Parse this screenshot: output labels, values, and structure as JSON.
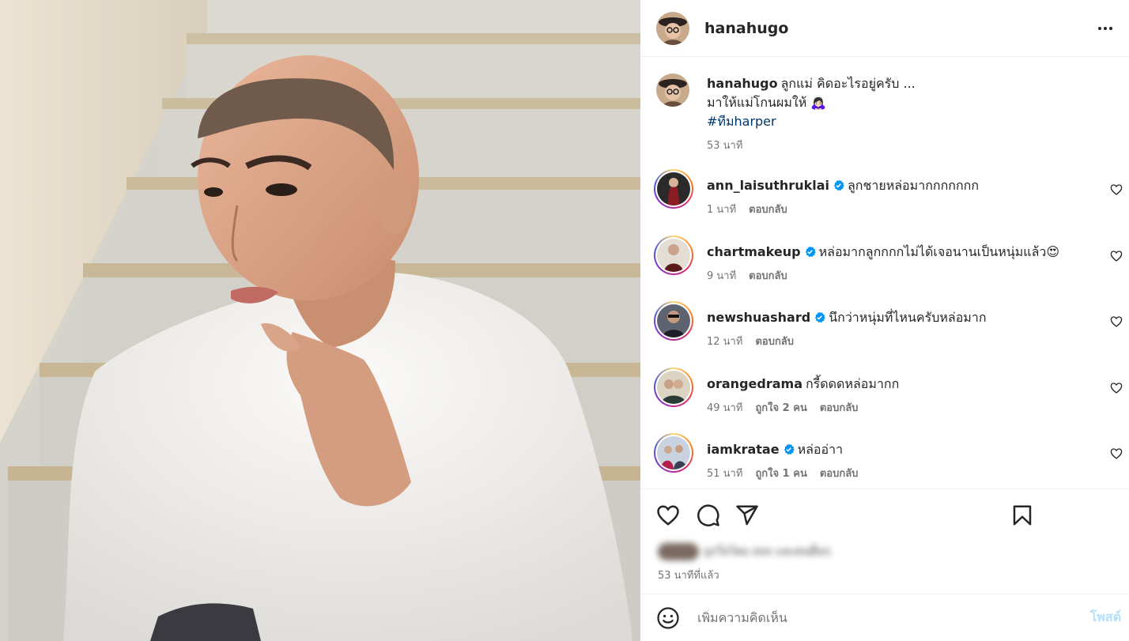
{
  "post": {
    "author": "hanahugo",
    "caption": {
      "username": "hanahugo",
      "line1": "ลูกแม่ คิดอะไรอยู่ครับ ...",
      "line2": "มาให้แม่โกนผมให้ 🙇🏻‍♀️",
      "hashtag": "#ทีมharper",
      "time": "53 นาที"
    },
    "timestamp": "53 นาทีที่แล้ว",
    "liked_by_blurred": "ถูกใจโดย xxx และคนอื่นๆ"
  },
  "comments": [
    {
      "username": "ann_laisuthruklai",
      "verified": true,
      "text": "ลูกชายหล่อมากกกกกกก",
      "time": "1 นาที",
      "likes": "",
      "reply": "ตอบกลับ"
    },
    {
      "username": "chartmakeup",
      "verified": true,
      "text": "หล่อมากลูกกกกไม่ได้เจอนานเป็นหนุ่มแล้ว😍",
      "time": "9 นาที",
      "likes": "",
      "reply": "ตอบกลับ"
    },
    {
      "username": "newshuashard",
      "verified": true,
      "text": "นึกว่าหนุ่มที่ไหนครับหล่อมาก",
      "time": "12 นาที",
      "likes": "",
      "reply": "ตอบกลับ"
    },
    {
      "username": "orangedrama",
      "verified": false,
      "text": "กรี้ดดดหล่อมากก",
      "time": "49 นาที",
      "likes": "ถูกใจ 2 คน",
      "reply": "ตอบกลับ"
    },
    {
      "username": "iamkratae",
      "verified": true,
      "text": "หล่ออ่าา",
      "time": "51 นาที",
      "likes": "ถูกใจ 1 คน",
      "reply": "ตอบกลับ"
    }
  ],
  "add_comment": {
    "placeholder": "เพิ่มความคิดเห็น",
    "post_label": "โพสต์"
  },
  "icons": {
    "more": "more-horizontal-icon",
    "like": "heart-icon",
    "comment": "comment-icon",
    "share": "send-icon",
    "save": "bookmark-icon",
    "emoji": "emoji-icon",
    "verified": "verified-badge-icon"
  },
  "colors": {
    "verified": "#0095f6",
    "link": "#00376b",
    "post_disabled": "#b2dffc"
  }
}
